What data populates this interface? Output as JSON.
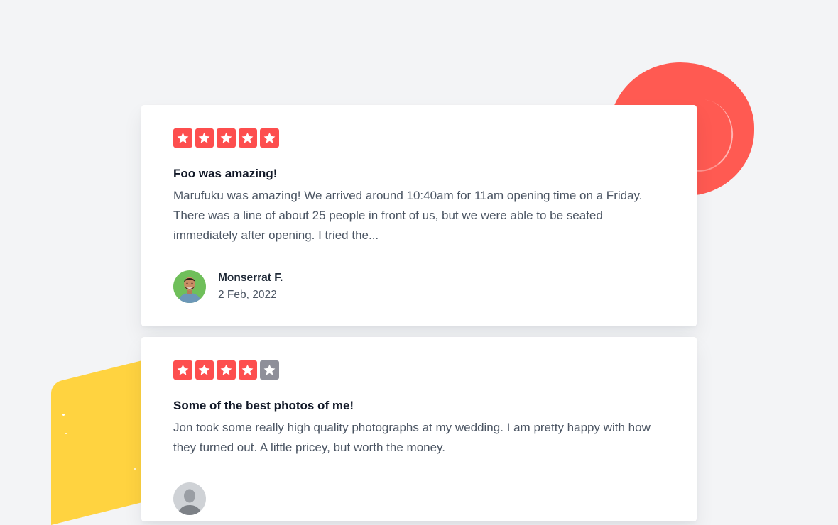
{
  "colors": {
    "star_filled": "#fd4e4e",
    "star_empty": "#8e8f99",
    "decor_red": "#ff5a52",
    "decor_yellow": "#ffd340",
    "background": "#f3f4f6"
  },
  "reviews": [
    {
      "rating": 5,
      "max_rating": 5,
      "title": "Foo was amazing!",
      "body": "Marufuku was amazing! We arrived around 10:40am for 11am opening time on a Friday. There was a line of about 25 people in front of us, but we were able to be seated immediately after opening. I tried the...",
      "author": "Monserrat F.",
      "date": "2 Feb, 2022",
      "avatar_icon": "user-avatar-photo"
    },
    {
      "rating": 4,
      "max_rating": 5,
      "title": "Some of the best photos of me!",
      "body": "Jon took some really high quality photographs at my wedding. I am pretty happy with how they turned out. A little pricey, but worth the money.",
      "author": "",
      "date": "",
      "avatar_icon": "user-avatar-photo"
    }
  ]
}
